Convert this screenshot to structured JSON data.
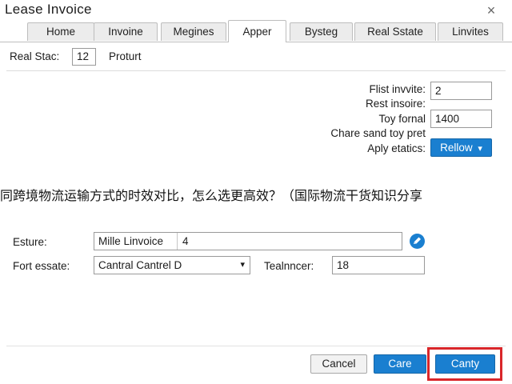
{
  "window": {
    "title": "Lease Invoice",
    "close_glyph": "×"
  },
  "tabs": [
    {
      "label": "Home"
    },
    {
      "label": "Invoine"
    },
    {
      "label": "Megines"
    },
    {
      "label": "Apper"
    },
    {
      "label": "Bysteg"
    },
    {
      "label": "Real Sstate"
    },
    {
      "label": "Linvites"
    }
  ],
  "active_tab": "Apper",
  "top_row": {
    "label": "Real Stac:",
    "value": "12",
    "suffix": "Proturt"
  },
  "details": {
    "first_invite_label": "Flist invvite:",
    "first_invite_value": "2",
    "rest_label": "Rest insoire:",
    "total_label": "Toy fornal",
    "total_value": "1400",
    "share_label": "Chare sand toy pret",
    "apply_label": "Aply etatics:",
    "apply_button": "Rellow",
    "apply_arrow": "▾"
  },
  "banner_text": "同跨境物流运输方式的时效对比，怎么选更高效？（国际物流干货知识分享",
  "form": {
    "esture_label": "Esture:",
    "esture_name": "Mille Linvoice",
    "esture_value": "4",
    "fort_label": "Fort essate:",
    "fort_select": "Cantral Cantrel D",
    "fort_arrow": "▾",
    "team_label": "Tealnncer:",
    "team_value": "18"
  },
  "buttons": {
    "cancel": "Cancel",
    "care": "Care",
    "canty": "Canty"
  },
  "colors": {
    "accent": "#1a7fd0",
    "highlight": "#d9262a"
  },
  "icons": {
    "close": "close-icon",
    "edit": "edit-icon",
    "dropdown": "chevron-down-icon"
  }
}
